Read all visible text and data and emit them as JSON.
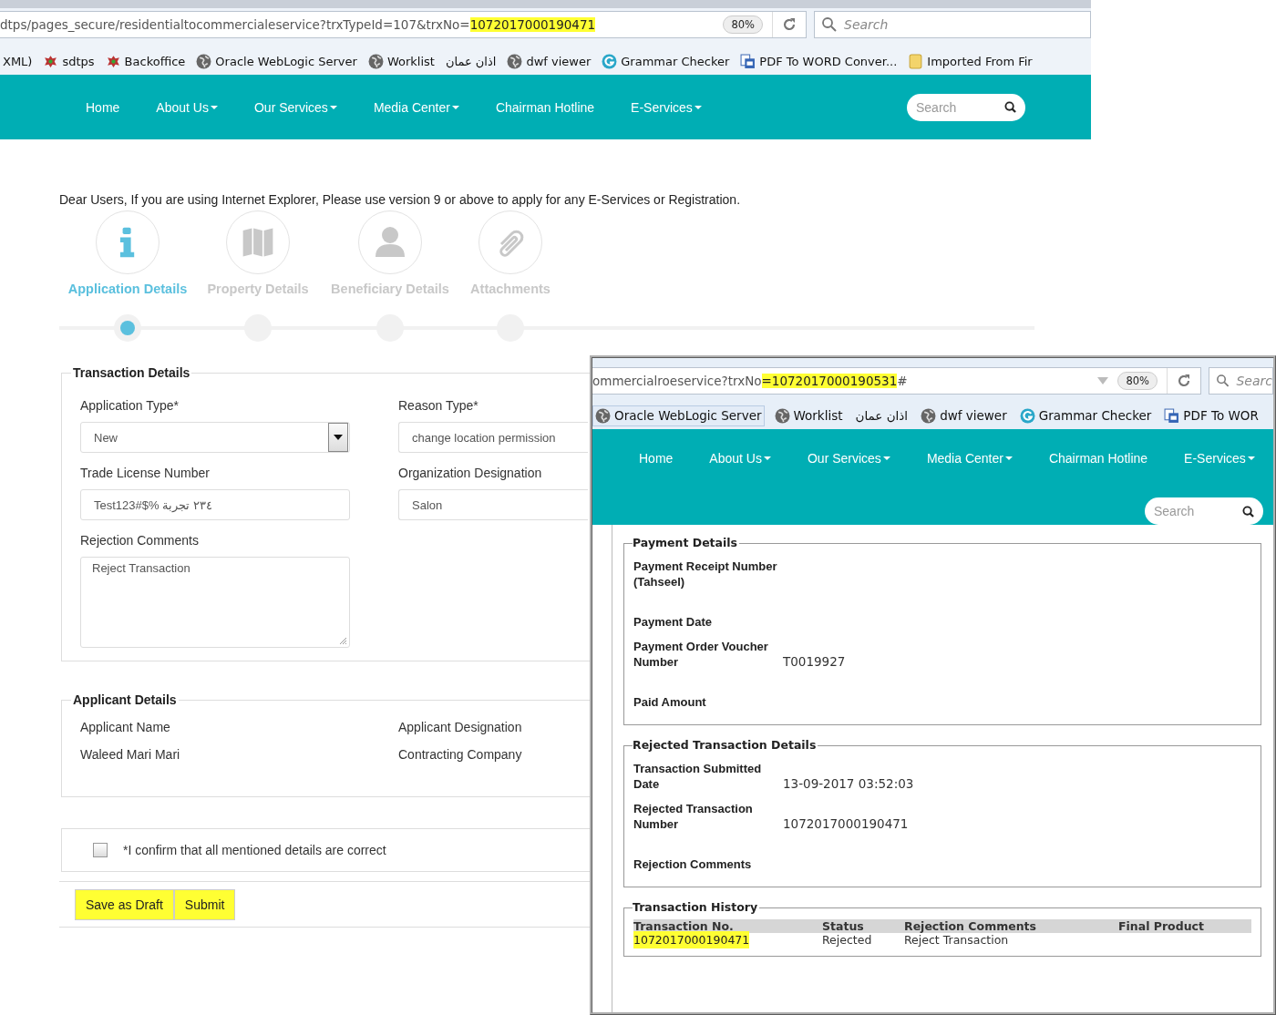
{
  "main_window": {
    "address_bar": {
      "url_parts": [
        {
          "text": "dtps/pages_secure/residentialtocommercialeservice?trxTypeId=107&trxNo=",
          "highlighted": false
        },
        {
          "text": "1072017000190471",
          "highlighted": true
        }
      ],
      "history_arrow": false,
      "zoom": "80%",
      "search_placeholder": "Search"
    },
    "bookmarks": [
      {
        "label": "XML)",
        "kind": "none",
        "hovered": false
      },
      {
        "label": "sdtps",
        "kind": "emblem",
        "hovered": false
      },
      {
        "label": "Backoffice",
        "kind": "emblem",
        "hovered": false
      },
      {
        "label": "Oracle WebLogic Server",
        "kind": "globe",
        "hovered": false
      },
      {
        "label": "Worklist",
        "kind": "globe",
        "hovered": false
      },
      {
        "label": "اذان عمان",
        "kind": "none",
        "hovered": false
      },
      {
        "label": "dwf viewer",
        "kind": "globe",
        "hovered": false
      },
      {
        "label": "Grammar Checker",
        "kind": "grammar",
        "hovered": false
      },
      {
        "label": "PDF To WORD Conver...",
        "kind": "pdf",
        "hovered": false
      },
      {
        "label": "Imported From Fir",
        "kind": "folder",
        "hovered": false
      }
    ],
    "nav": {
      "items": [
        {
          "label": "Home",
          "dropdown": false
        },
        {
          "label": "About Us",
          "dropdown": true
        },
        {
          "label": "Our Services",
          "dropdown": true
        },
        {
          "label": "Media Center",
          "dropdown": true
        },
        {
          "label": "Chairman Hotline",
          "dropdown": false
        },
        {
          "label": "E-Services",
          "dropdown": true
        }
      ],
      "search_placeholder": "Search"
    },
    "notice": "Dear Users, If you are using Internet Explorer, Please use version 9 or above to apply for any E-Services or Registration.",
    "steps": [
      {
        "label": "Application Details",
        "kind": "info",
        "selected": true
      },
      {
        "label": "Property Details",
        "kind": "map",
        "selected": false
      },
      {
        "label": "Beneficiary Details",
        "kind": "person",
        "selected": false
      },
      {
        "label": "Attachments",
        "kind": "clip",
        "selected": false
      }
    ],
    "transaction_details": {
      "title": "Transaction Details",
      "fields": [
        {
          "label": "Application Type*",
          "kind": "select",
          "value": "New"
        },
        {
          "label": "Reason Type*",
          "kind": "text",
          "value": "change location permission"
        },
        {
          "label": "Trade License Number",
          "kind": "text",
          "value": "Test123#$% ٢٣٤ تجربة"
        },
        {
          "label": "Organization Designation",
          "kind": "text",
          "value": "Salon"
        },
        {
          "label": "Rejection Comments",
          "kind": "textarea",
          "value": "Reject Transaction"
        }
      ]
    },
    "applicant_details": {
      "title": "Applicant Details",
      "items": [
        {
          "label": "Applicant Name",
          "value": "Waleed Mari Mari"
        },
        {
          "label": "Applicant Designation",
          "value": "Contracting Company"
        }
      ]
    },
    "confirm": {
      "label": "*I confirm that all mentioned details are correct",
      "checked": false
    },
    "buttons": [
      {
        "label": "Save as Draft",
        "highlighted": true
      },
      {
        "label": "Submit",
        "highlighted": true
      }
    ]
  },
  "overlay_window": {
    "address_bar": {
      "url_parts": [
        {
          "text": "ommercialroeservice?trxNo",
          "highlighted": false
        },
        {
          "text": "=1072017000190531",
          "highlighted": true
        },
        {
          "text": "#",
          "highlighted": false
        }
      ],
      "history_arrow": true,
      "zoom": "80%",
      "search_placeholder": "Searc"
    },
    "bookmarks": [
      {
        "label": "Oracle WebLogic Server",
        "kind": "globe",
        "hovered": true
      },
      {
        "label": "Worklist",
        "kind": "globe",
        "hovered": false
      },
      {
        "label": "اذان عمان",
        "kind": "none",
        "hovered": false
      },
      {
        "label": "dwf viewer",
        "kind": "globe",
        "hovered": false
      },
      {
        "label": "Grammar Checker",
        "kind": "grammar",
        "hovered": false
      },
      {
        "label": "PDF To WOR",
        "kind": "pdf",
        "hovered": false
      }
    ],
    "nav": {
      "items": [
        {
          "label": "Home",
          "dropdown": false
        },
        {
          "label": "About Us",
          "dropdown": true
        },
        {
          "label": "Our Services",
          "dropdown": true
        },
        {
          "label": "Media Center",
          "dropdown": true
        },
        {
          "label": "Chairman Hotline",
          "dropdown": false
        },
        {
          "label": "E-Services",
          "dropdown": true
        }
      ],
      "search_placeholder": "Search"
    },
    "payment_details": {
      "title": "Payment Details",
      "rows": [
        {
          "label": "Payment Receipt Number (Tahseel)"
        },
        {
          "label": "Payment Date"
        },
        {
          "label": "Payment Order Voucher Number",
          "value": "T0019927"
        },
        {
          "label": "Paid Amount"
        }
      ]
    },
    "rejected_details": {
      "title": "Rejected Transaction Details",
      "rows": [
        {
          "label": "Transaction Submitted Date",
          "value": "13-09-2017 03:52:03"
        },
        {
          "label": "Rejected Transaction Number",
          "value": "1072017000190471"
        },
        {
          "label": "Rejection Comments"
        }
      ]
    },
    "transaction_history": {
      "title": "Transaction History",
      "columns": [
        "Transaction No.",
        "Status",
        "Rejection Comments",
        "Final Product"
      ],
      "rows": [
        [
          {
            "text": "1072017000190471",
            "highlighted": true
          },
          {
            "text": "Rejected",
            "highlighted": false
          },
          {
            "text": "Reject Transaction",
            "highlighted": false
          }
        ]
      ]
    }
  }
}
